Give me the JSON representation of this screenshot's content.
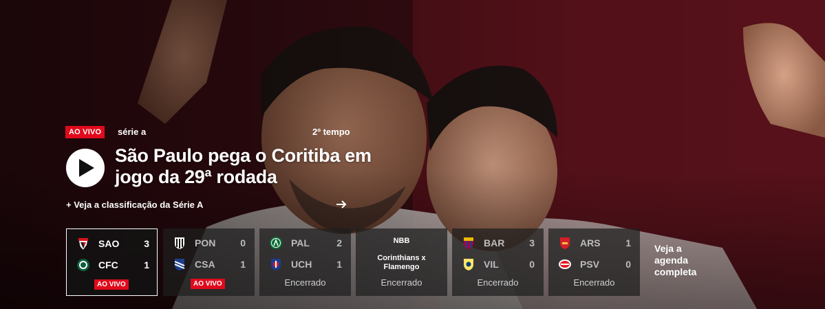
{
  "hero": {
    "live_badge": "AO VIVO",
    "competition": "série a",
    "period": "2º tempo",
    "headline": "São Paulo pega o Coritiba em jogo da 29ª rodada",
    "standings_link": "+ Veja a classificação da Série A"
  },
  "scoreboard": [
    {
      "home": {
        "abbr": "SAO",
        "score": "3"
      },
      "away": {
        "abbr": "CFC",
        "score": "1"
      },
      "status": "AO VIVO"
    },
    {
      "home": {
        "abbr": "PON",
        "score": "0"
      },
      "away": {
        "abbr": "CSA",
        "score": "1"
      },
      "status": "AO VIVO"
    },
    {
      "home": {
        "abbr": "PAL",
        "score": "2"
      },
      "away": {
        "abbr": "UCH",
        "score": "1"
      },
      "status": "Encerrado"
    },
    {
      "league": "NBB",
      "match": "Corinthians x Flamengo",
      "status": "Encerrado"
    },
    {
      "home": {
        "abbr": "BAR",
        "score": "3"
      },
      "away": {
        "abbr": "VIL",
        "score": "0"
      },
      "status": "Encerrado"
    },
    {
      "home": {
        "abbr": "ARS",
        "score": "1"
      },
      "away": {
        "abbr": "PSV",
        "score": "0"
      },
      "status": "Encerrado"
    }
  ],
  "agenda_link": "Veja a agenda completa",
  "icons": {
    "play": "play-icon",
    "arrow": "arrow-right-icon"
  },
  "colors": {
    "live_red": "#e00a1c",
    "hero_bg": "#5a1119"
  }
}
